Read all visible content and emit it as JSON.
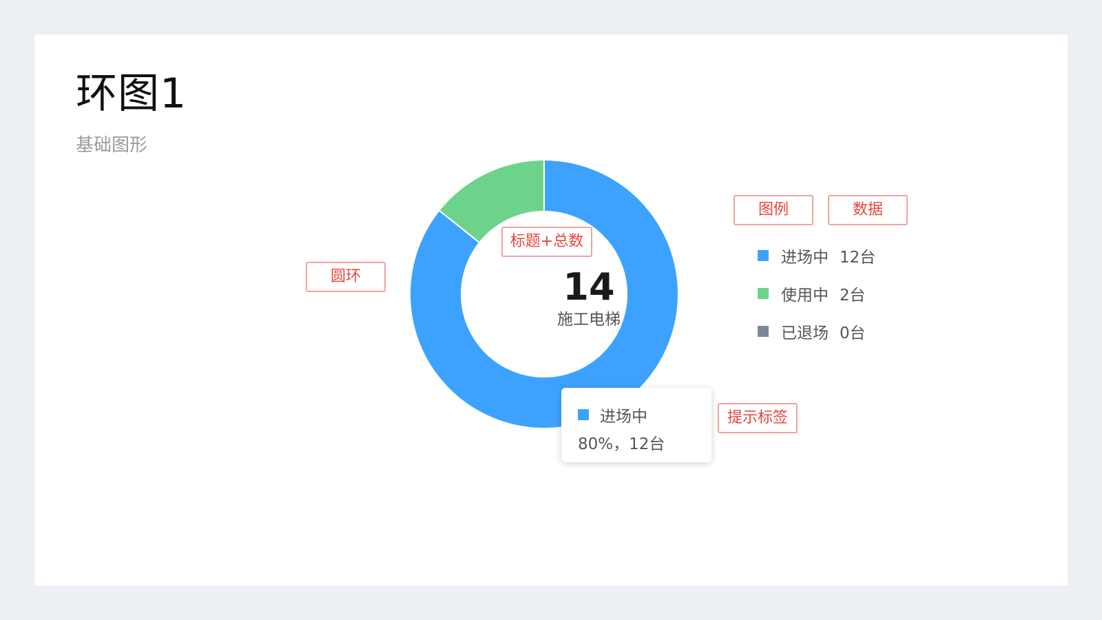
{
  "page": {
    "title": "环图1",
    "subtitle": "基础图形"
  },
  "annotations": {
    "ring": "圆环",
    "title_total": "标题+总数",
    "legend": "图例",
    "data": "数据",
    "tooltip": "提示标签"
  },
  "chart_data": {
    "type": "pie",
    "variant": "donut",
    "center": {
      "total": "14",
      "label": "施工电梯"
    },
    "categories": [
      "进场中",
      "使用中",
      "已退场"
    ],
    "values": [
      12,
      2,
      0
    ],
    "colors": [
      "#3da2fd",
      "#6dd38a",
      "#7d8797"
    ],
    "legend": [
      {
        "name": "进场中",
        "value_text": "12台"
      },
      {
        "name": "使用中",
        "value_text": "2台"
      },
      {
        "name": "已退场",
        "value_text": "0台"
      }
    ],
    "legend_position": "right"
  },
  "tooltip": {
    "name": "进场中",
    "detail": "80%，12台",
    "color": "#3da2fd"
  }
}
